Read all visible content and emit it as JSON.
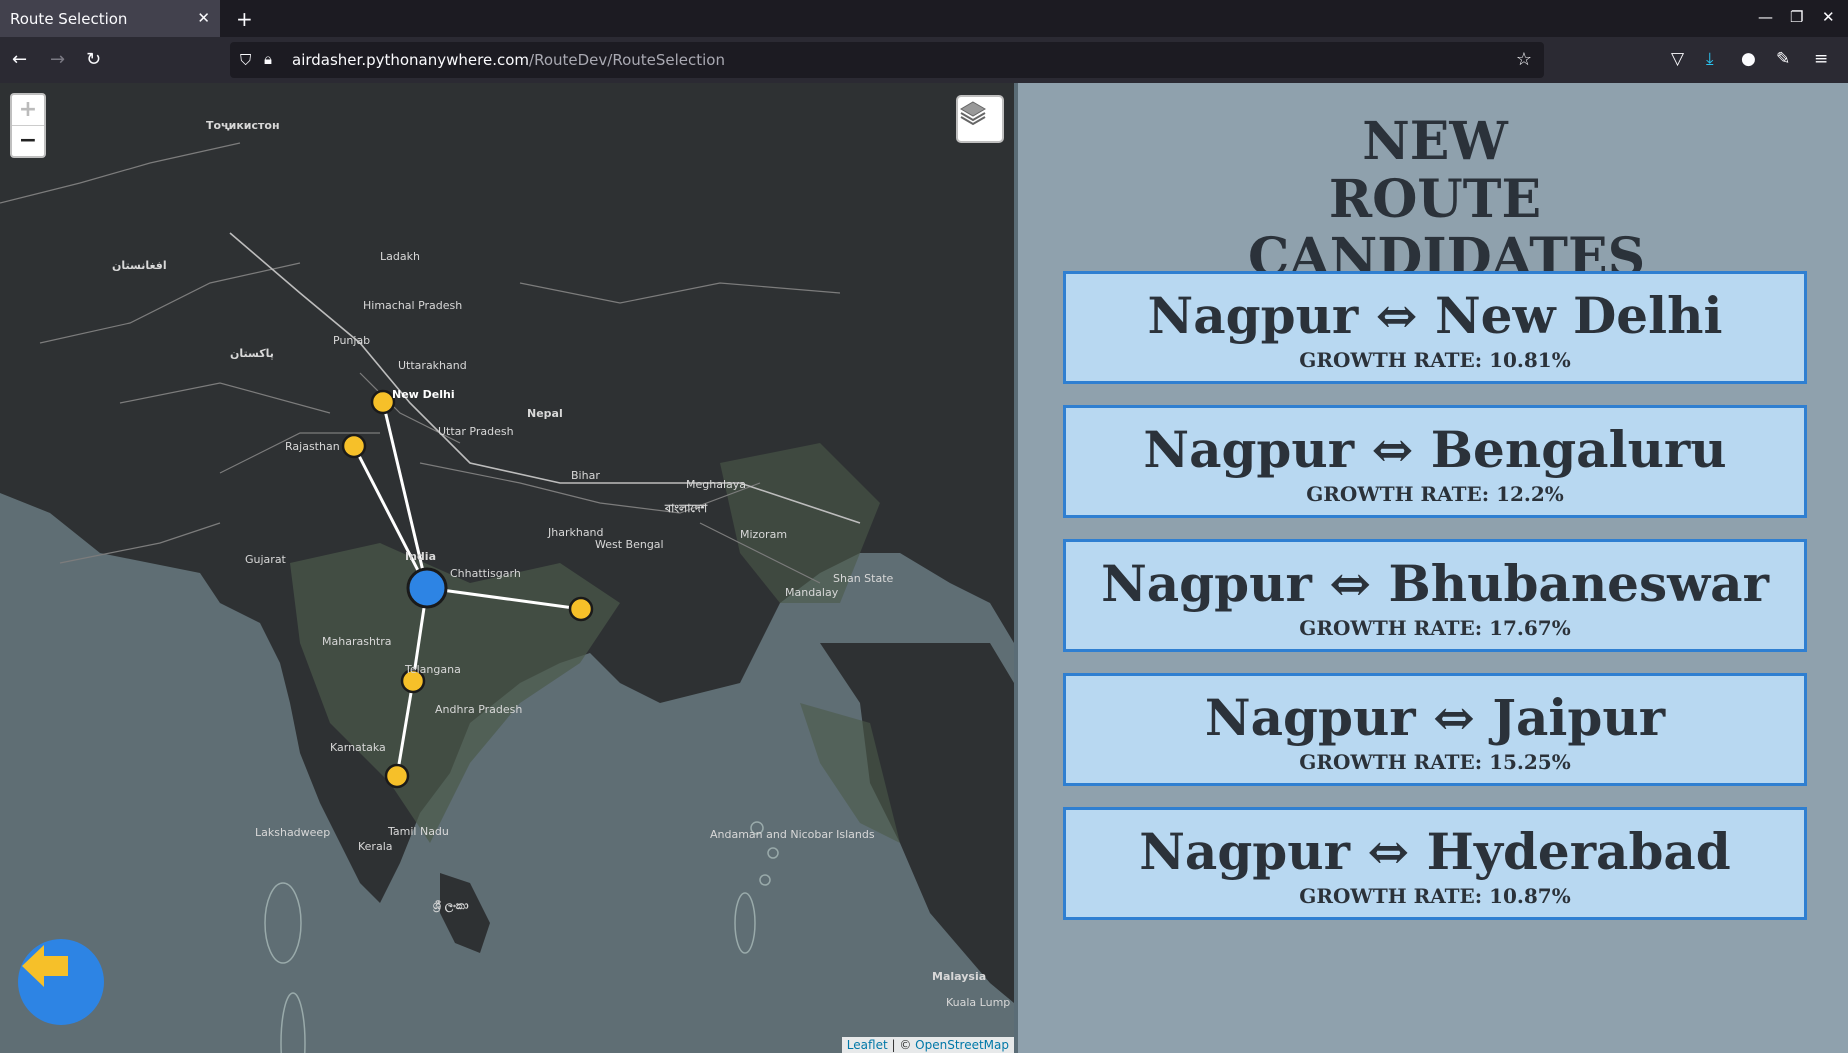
{
  "browser": {
    "tab_title": "Route Selection",
    "url_domain": "airdasher.pythonanywhere.com",
    "url_path": "/RouteDev/RouteSelection"
  },
  "map": {
    "zoom_in": "+",
    "zoom_out": "−",
    "attribution_leaflet": "Leaflet",
    "attribution_sep": " | © ",
    "attribution_osm": "OpenStreetMap",
    "labels": {
      "tajik": "Тоҷикистон",
      "afghanistan": "افغانستان",
      "pakistan": "پاکستان",
      "new_delhi": "New Delhi",
      "rajasthan": "Rajasthan",
      "uttar_pradesh": "Uttar Pradesh",
      "nepal": "Nepal",
      "bihar": "Bihar",
      "india": "India",
      "chhattisgarh": "Chhattisgarh",
      "maharashtra": "Maharashtra",
      "telangana": "Telangana",
      "karnataka": "Karnataka",
      "andhra": "Andhra Pradesh",
      "tamil_nadu": "Tamil Nadu",
      "kerala": "Kerala",
      "gujarat": "Gujarat",
      "west_bengal": "West Bengal",
      "lakshadweep": "Lakshadweep",
      "shan_state": "Shan State",
      "mandalay": "Mandalay",
      "malaysia": "Malaysia",
      "kuala_lumpur": "Kuala Lump",
      "bangladesh": "বাংলাদেশ",
      "sri_lanka": "ශ්‍රී ලංකා",
      "ladakh": "Ladakh",
      "punjab": "Punjab",
      "himachal": "Himachal Pradesh",
      "uttarakhand": "Uttarakhand",
      "jharkhand": "Jharkhand",
      "meghalaya": "Meghalaya",
      "mizoram": "Mizoram",
      "andaman": "Andaman and Nicobar Islands"
    },
    "colors": {
      "hub": "#2d84e4",
      "destination": "#f6c029",
      "route_line": "#ffffff"
    }
  },
  "panel": {
    "title": "NEW ROUTE CANDIDATES",
    "growth_prefix": "GROWTH RATE: ",
    "candidates": [
      {
        "route": "Nagpur ⇔ New Delhi",
        "growth": "GROWTH RATE: 10.81%"
      },
      {
        "route": "Nagpur ⇔ Bengaluru",
        "growth": "GROWTH RATE: 12.2%"
      },
      {
        "route": "Nagpur ⇔ Bhubaneswar",
        "growth": "GROWTH RATE: 17.67%"
      },
      {
        "route": "Nagpur ⇔ Jaipur",
        "growth": "GROWTH RATE: 15.25%"
      },
      {
        "route": "Nagpur ⇔ Hyderabad",
        "growth": "GROWTH RATE: 10.87%"
      }
    ]
  }
}
